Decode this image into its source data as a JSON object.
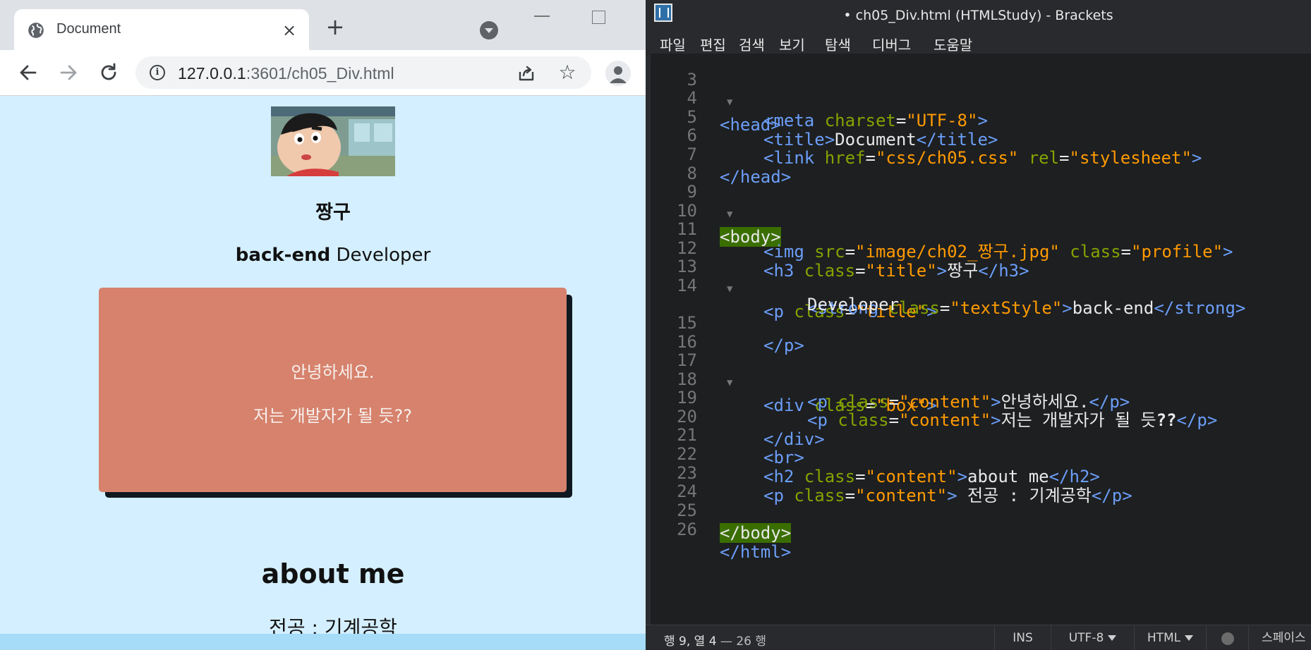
{
  "browser": {
    "tab_title": "Document",
    "tab_close": "×",
    "new_tab": "+",
    "url_host": "127.0.0.1",
    "url_rest": ":3601/ch05_Div.html",
    "star": "☆"
  },
  "page": {
    "name": "짱구",
    "role_strong": "back-end",
    "role_rest": " Developer",
    "box_line1": "안녕하세요.",
    "box_line2": "저는 개발자가 될 듯??",
    "about_heading": "about me",
    "major": "전공 : 기계공학"
  },
  "editor": {
    "window_title": "• ch05_Div.html (HTMLStudy) - Brackets",
    "menu": [
      "파일",
      "편집",
      "검색",
      "보기",
      "탐색",
      "디버그",
      "도움말"
    ],
    "lines": [
      {
        "num": "3",
        "fold": "▼"
      },
      {
        "num": "4"
      },
      {
        "num": "5"
      },
      {
        "num": "6"
      },
      {
        "num": "7"
      },
      {
        "num": "8"
      },
      {
        "num": "9",
        "fold": "▼"
      },
      {
        "num": "10"
      },
      {
        "num": "11"
      },
      {
        "num": "12"
      },
      {
        "num": "13",
        "fold": "▼"
      },
      {
        "num": "14"
      },
      {
        "num": ""
      },
      {
        "num": "15"
      },
      {
        "num": "16"
      },
      {
        "num": "17",
        "fold": "▼"
      },
      {
        "num": "18"
      },
      {
        "num": "19"
      },
      {
        "num": "20"
      },
      {
        "num": "21"
      },
      {
        "num": "22"
      },
      {
        "num": "23"
      },
      {
        "num": "24"
      },
      {
        "num": "25"
      },
      {
        "num": "26"
      }
    ],
    "code": {
      "l3": "<head>",
      "l4_tag": "<meta",
      "l4_attr": " charset",
      "l4_eq": "=",
      "l4_val": "\"UTF-8\"",
      "l4_end": ">",
      "l5_open": "<title>",
      "l5_text": "Document",
      "l5_close": "</title>",
      "l6_tag": "<link",
      "l6_a1": " href",
      "l6_v1": "\"css/ch05.css\"",
      "l6_a2": " rel",
      "l6_v2": "\"stylesheet\"",
      "l6_end": ">",
      "l7": "</head>",
      "l9": "<body>",
      "l11_tag": "<img",
      "l11_a1": " src",
      "l11_v1": "\"image/ch02_짱구.jpg\"",
      "l11_a2": " class",
      "l11_v2": "\"profile\"",
      "l11_end": ">",
      "l12_tag": "<h3",
      "l12_a": " class",
      "l12_v": "\"title\"",
      "l12_gt": ">",
      "l12_text": "짱구",
      "l12_close": "</h3>",
      "l13_tag": "<p",
      "l13_a": " class",
      "l13_v": "\"title\"",
      "l13_end": ">",
      "l14_tag": "<strong",
      "l14_a": " class",
      "l14_v": "\"textStyle\"",
      "l14_gt": ">",
      "l14_text": "back-end",
      "l14_close": "</strong>",
      "l14b_text": "Developer",
      "l15": "</p>",
      "l17_tag": "<div",
      "l17_a": " class",
      "l17_v": "\"box\"",
      "l17_end": ">",
      "l18_tag": "<p",
      "l18_a": " class",
      "l18_v": "\"content\"",
      "l18_gt": ">",
      "l18_text": "안녕하세요.",
      "l18_close": "</p>",
      "l19_tag": "<p",
      "l19_a": " class",
      "l19_v": "\"content\"",
      "l19_gt": ">",
      "l19_text": "저는 개발자가 될 듯",
      "l19_q": "??",
      "l19_close": "</p>",
      "l20": "</div>",
      "l21": "<br>",
      "l22_tag": "<h2",
      "l22_a": " class",
      "l22_v": "\"content\"",
      "l22_gt": ">",
      "l22_text": "about me",
      "l22_close": "</h2>",
      "l23_tag": "<p",
      "l23_a": " class",
      "l23_v": "\"content\"",
      "l23_gt": ">",
      "l23_text": " 전공 : 기계공학",
      "l23_close": "</p>",
      "l25": "</body>",
      "l26": "</html>"
    },
    "status": {
      "cursor_label": "행 9, 열 4",
      "line_count": " — 26 행",
      "ins": "INS",
      "encoding": "UTF-8",
      "language": "HTML",
      "indent": "스페이스"
    }
  }
}
